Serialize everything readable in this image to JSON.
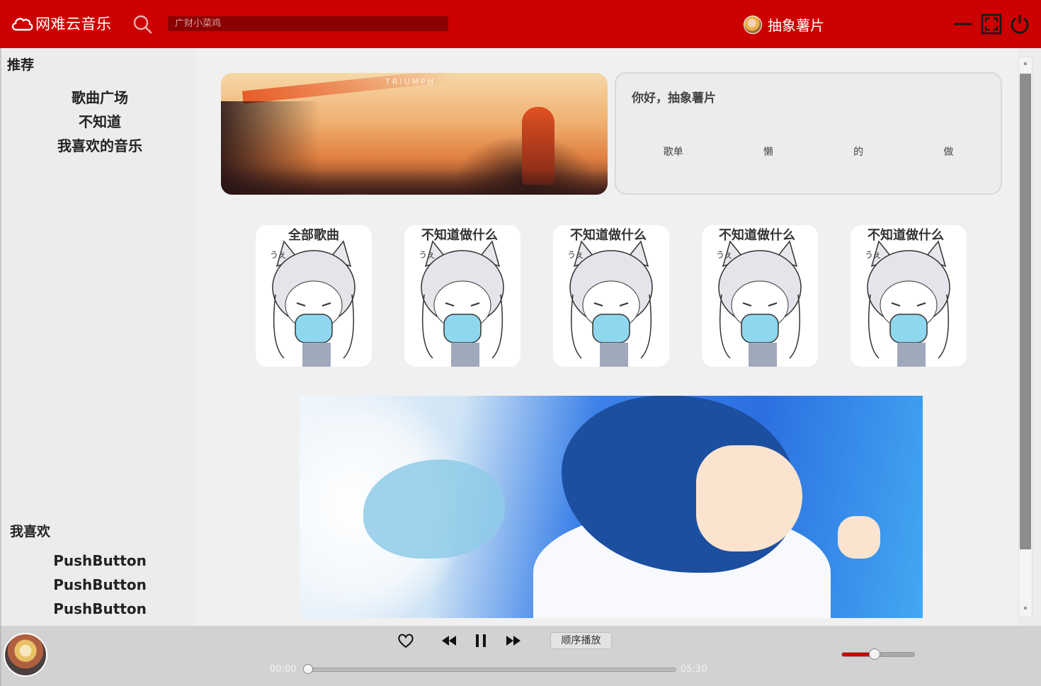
{
  "app": {
    "name": "网难云音乐"
  },
  "search": {
    "placeholder": "广财小菜鸡"
  },
  "user": {
    "name": "抽象薯片"
  },
  "sidebar": {
    "recommend_title": "推荐",
    "recommend_items": [
      "歌曲广场",
      "不知道",
      "我喜欢的音乐"
    ],
    "favorites_title": "我喜欢",
    "favorites_items": [
      "PushButton",
      "PushButton",
      "PushButton"
    ]
  },
  "banner": {
    "caption": "TRIUMPH"
  },
  "welcome": {
    "greeting": "你好，抽象薯片",
    "tags": [
      "歌单",
      "懒",
      "的",
      "做"
    ]
  },
  "cards": [
    {
      "title": "全部歌曲"
    },
    {
      "title": "不知道做什么"
    },
    {
      "title": "不知道做什么"
    },
    {
      "title": "不知道做什么"
    },
    {
      "title": "不知道做什么"
    }
  ],
  "player": {
    "play_mode": "顺序播放",
    "current_time": "00:00",
    "total_time": "05:30",
    "progress": 0.0,
    "volume": 0.45,
    "controls": [
      "heart-icon",
      "previous-icon",
      "pause-icon",
      "next-icon"
    ]
  },
  "colors": {
    "accent": "#cc0000",
    "search_bg": "#8b0000",
    "background": "#ececec"
  }
}
